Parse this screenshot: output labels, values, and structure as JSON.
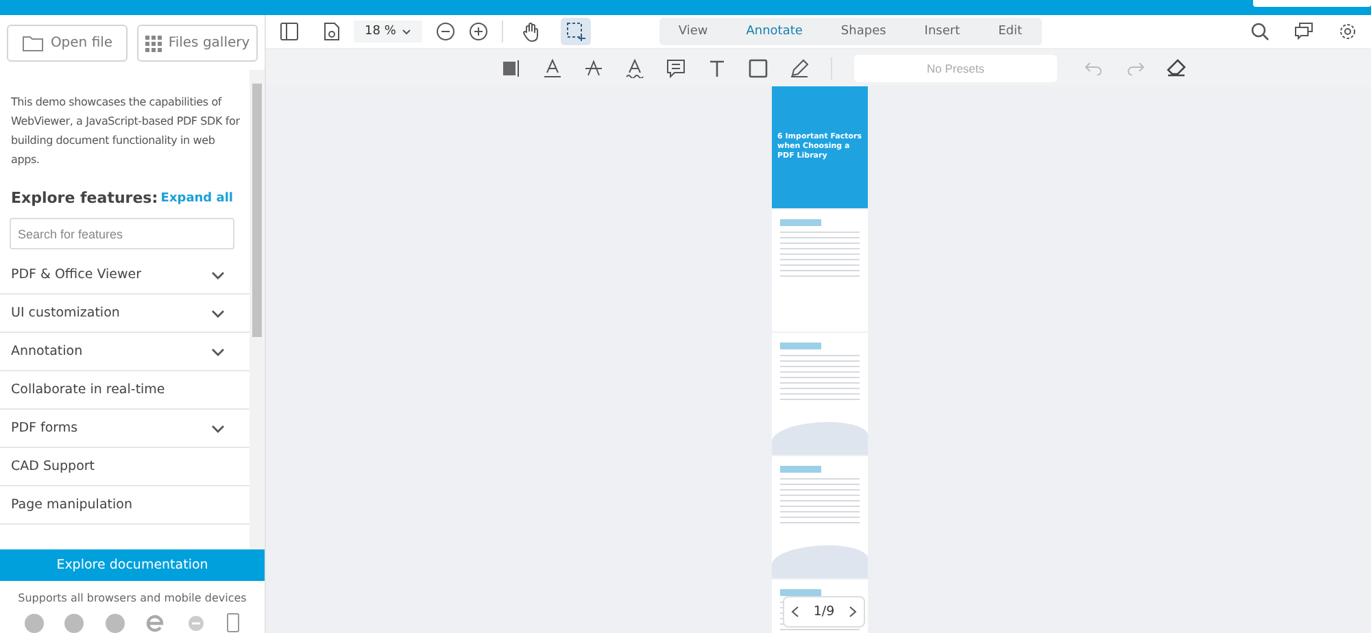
{
  "sidebar": {
    "buttons": [
      {
        "kind": "folder",
        "label": "Open file"
      },
      {
        "kind": "grid",
        "label": "Files gallery"
      }
    ],
    "intro": "This demo showcases the capabilities of WebViewer, a JavaScript-based PDF SDK for building document functionality in web apps.",
    "heading": "Explore features:",
    "expand_all": "Expand all",
    "search": {
      "placeholder": "Search for features"
    },
    "features": [
      {
        "label": "PDF & Office Viewer",
        "expandable": true
      },
      {
        "label": "UI customization",
        "expandable": true
      },
      {
        "label": "Annotation",
        "expandable": true
      },
      {
        "label": "Collaborate in real-time",
        "expandable": false
      },
      {
        "label": "PDF forms",
        "expandable": true
      },
      {
        "label": "CAD Support",
        "expandable": false
      },
      {
        "label": "Page manipulation",
        "expandable": false
      }
    ],
    "docs_button": "Explore documentation",
    "supports": "Supports all browsers and mobile devices"
  },
  "toolbar": {
    "zoom": "18 %",
    "tools": [
      {
        "kind": "pan",
        "selected": false
      },
      {
        "kind": "select",
        "selected": true
      }
    ],
    "tabs": [
      {
        "label": "View",
        "selected": false
      },
      {
        "label": "Annotate",
        "selected": true
      },
      {
        "label": "Shapes",
        "selected": false
      },
      {
        "label": "Insert",
        "selected": false
      },
      {
        "label": "Edit",
        "selected": false
      }
    ],
    "presets": {
      "placeholder": "No Presets"
    }
  },
  "document": {
    "cover_title": "6 Important Factors when Choosing a PDF Library",
    "page_indicator": "1/9"
  }
}
